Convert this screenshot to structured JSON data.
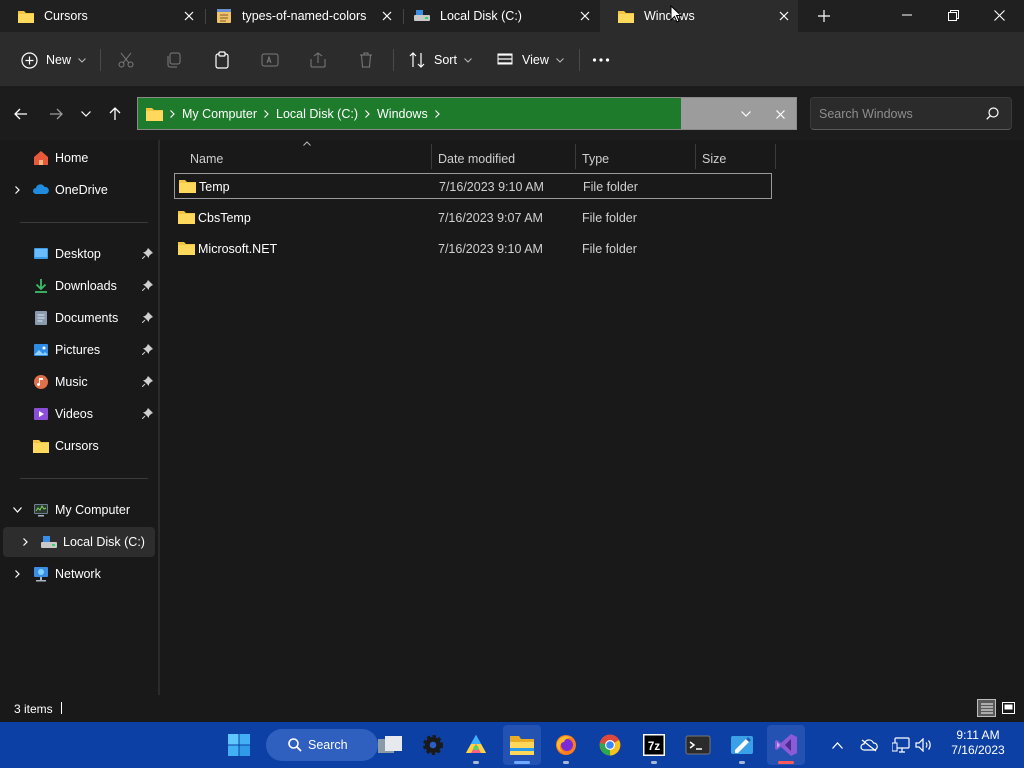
{
  "tabs": [
    {
      "label": "Cursors",
      "icon": "folder-icon",
      "active": false
    },
    {
      "label": "types-of-named-colors",
      "icon": "notepad-icon",
      "active": false
    },
    {
      "label": "Local Disk (C:)",
      "icon": "drive-icon",
      "active": false
    },
    {
      "label": "Windows",
      "icon": "folder-icon",
      "active": true
    }
  ],
  "toolbar": {
    "new_label": "New",
    "sort_label": "Sort",
    "view_label": "View"
  },
  "breadcrumb": [
    "My Computer",
    "Local Disk (C:)",
    "Windows"
  ],
  "search": {
    "placeholder": "Search Windows"
  },
  "sidebar": {
    "top": [
      {
        "label": "Home",
        "icon": "home-icon"
      },
      {
        "label": "OneDrive",
        "icon": "onedrive-icon"
      }
    ],
    "quick_access": [
      {
        "label": "Desktop",
        "icon": "desktop-icon",
        "pinned": true
      },
      {
        "label": "Downloads",
        "icon": "downloads-icon",
        "pinned": true
      },
      {
        "label": "Documents",
        "icon": "documents-icon",
        "pinned": true
      },
      {
        "label": "Pictures",
        "icon": "pictures-icon",
        "pinned": true
      },
      {
        "label": "Music",
        "icon": "music-icon",
        "pinned": true
      },
      {
        "label": "Videos",
        "icon": "videos-icon",
        "pinned": true
      },
      {
        "label": "Cursors",
        "icon": "folder-icon",
        "pinned": false
      }
    ],
    "tree": [
      {
        "label": "My Computer",
        "icon": "computer-icon",
        "expanded": true
      },
      {
        "label": "Local Disk (C:)",
        "icon": "drive-icon",
        "selected": true
      },
      {
        "label": "Network",
        "icon": "network-icon"
      }
    ]
  },
  "columns": [
    "Name",
    "Date modified",
    "Type",
    "Size"
  ],
  "files": [
    {
      "name": "Temp",
      "modified": "7/16/2023 9:10 AM",
      "type": "File folder",
      "size": ""
    },
    {
      "name": "CbsTemp",
      "modified": "7/16/2023 9:07 AM",
      "type": "File folder",
      "size": ""
    },
    {
      "name": "Microsoft.NET",
      "modified": "7/16/2023 9:10 AM",
      "type": "File folder",
      "size": ""
    }
  ],
  "status": {
    "item_count": "3 items"
  },
  "taskbar": {
    "search_label": "Search",
    "apps": [
      "windows-start-icon",
      "task-view-icon",
      "settings-icon",
      "paint-icon",
      "file-explorer-icon",
      "firefox-icon",
      "chrome-icon",
      "7zip-icon",
      "terminal-icon",
      "whiteboard-icon",
      "visual-studio-icon"
    ]
  },
  "clock": {
    "time": "9:11 AM",
    "date": "7/16/2023"
  },
  "colors": {
    "address_green": "#1e7b2c",
    "taskbar_blue": "#0d40a5",
    "folder_yellow": "#f4c542",
    "background": "#191919"
  }
}
